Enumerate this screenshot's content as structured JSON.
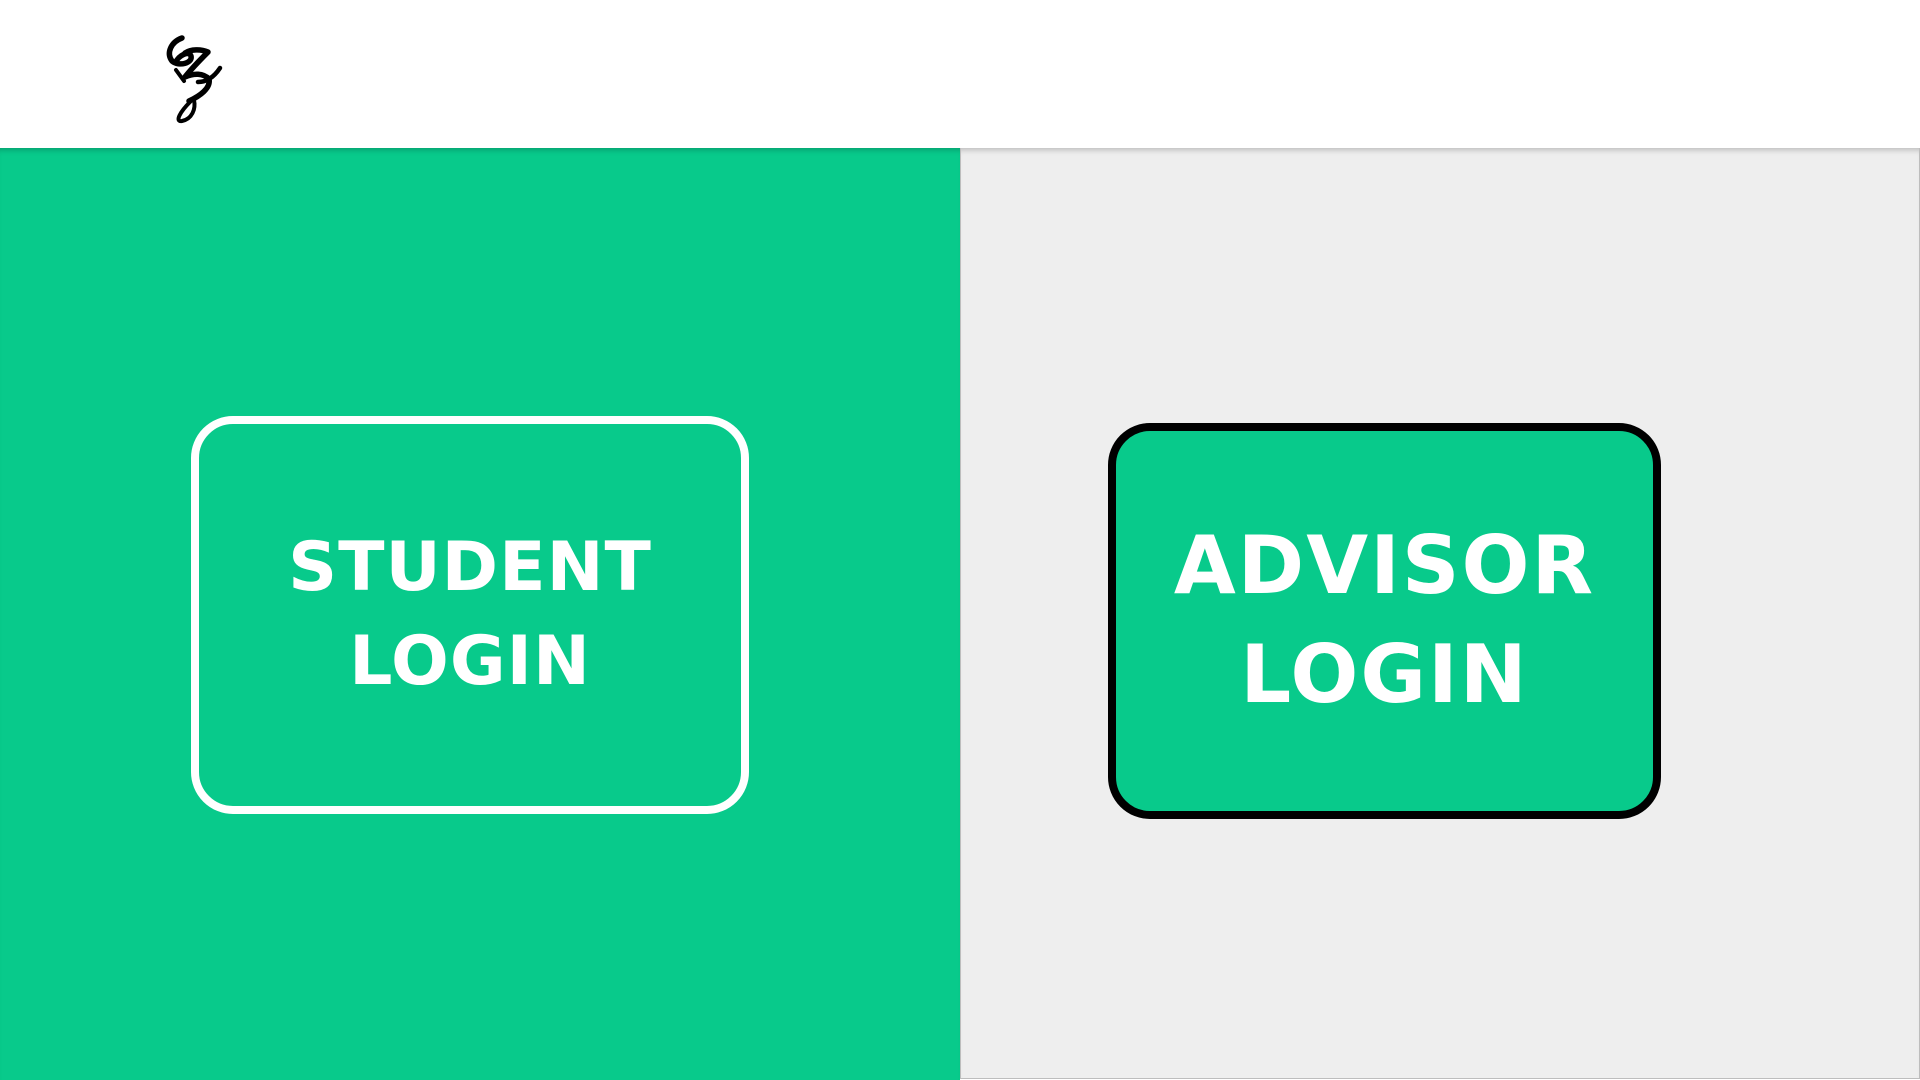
{
  "brand": {
    "logo_text": "ez",
    "logo_icon": "ez-script-logo-icon"
  },
  "panels": {
    "student": {
      "background_color": "#08ca8b",
      "button_label": "STUDENT\nLOGIN",
      "button_border_color": "#ffffff"
    },
    "advisor": {
      "background_color": "#eeeeee",
      "button_label": "ADVISOR\nLOGIN",
      "button_fill_color": "#08ca8b",
      "button_border_color": "#000000"
    }
  },
  "colors": {
    "accent": "#08ca8b",
    "text_on_accent": "#ffffff"
  }
}
